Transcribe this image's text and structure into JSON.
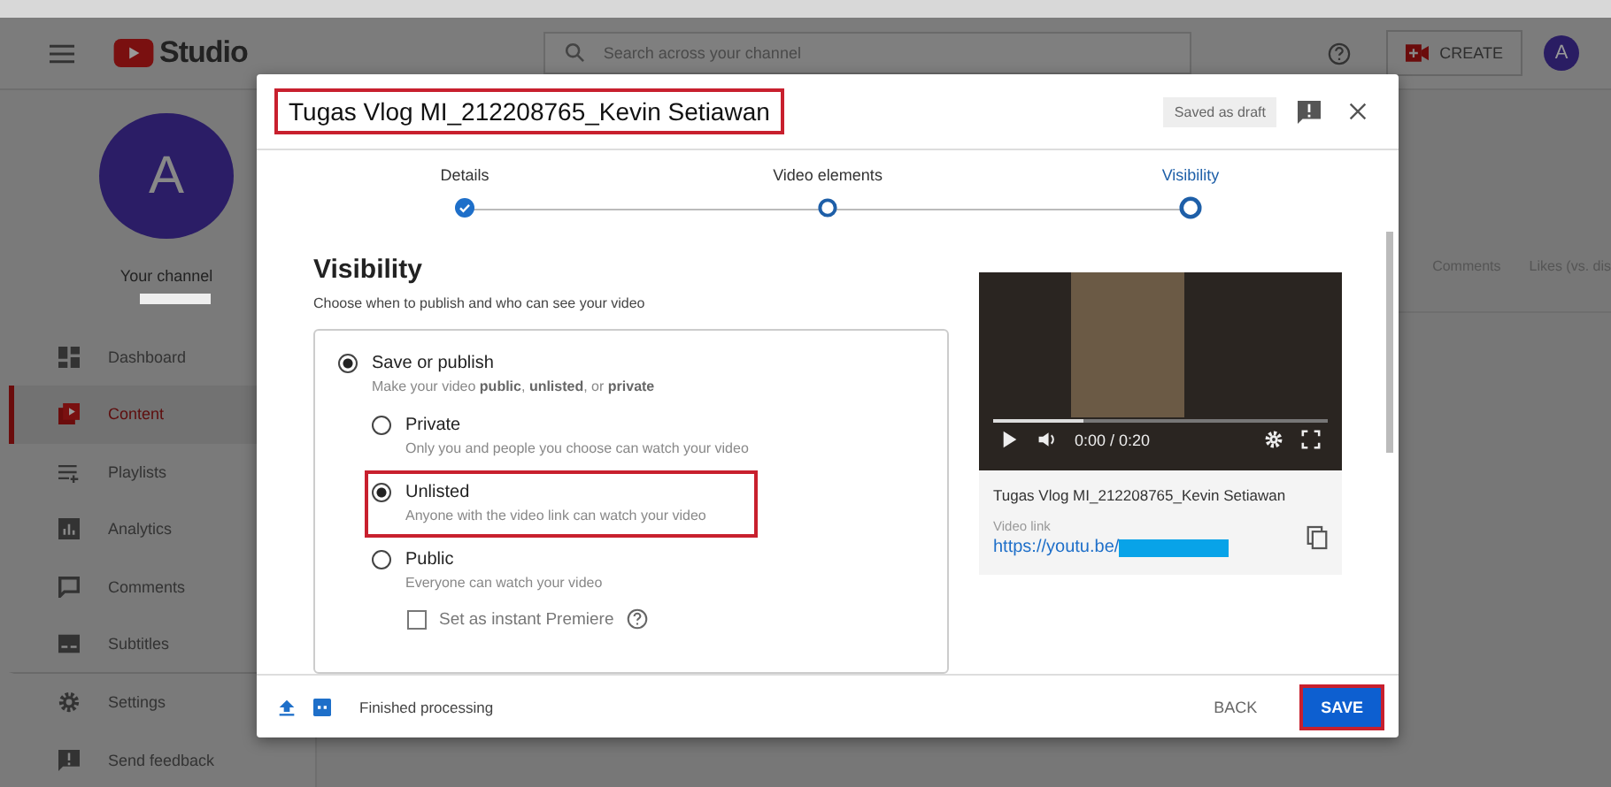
{
  "app_bar": {
    "logo_text": "Studio",
    "search_placeholder": "Search across your channel",
    "create_label": "CREATE",
    "avatar_letter": "A"
  },
  "sidebar": {
    "avatar_letter": "A",
    "channel_label": "Your channel",
    "items": [
      {
        "label": "Dashboard",
        "kind": "dashboard",
        "selected": false
      },
      {
        "label": "Content",
        "kind": "content",
        "selected": true
      },
      {
        "label": "Playlists",
        "kind": "playlists",
        "selected": false
      },
      {
        "label": "Analytics",
        "kind": "analytics",
        "selected": false
      },
      {
        "label": "Comments",
        "kind": "comments",
        "selected": false
      },
      {
        "label": "Subtitles",
        "kind": "subtitles",
        "selected": false
      },
      {
        "label": "Settings",
        "kind": "settings",
        "selected": false
      },
      {
        "label": "Send feedback",
        "kind": "feedback",
        "selected": false
      }
    ]
  },
  "background_table": {
    "columns": [
      "Comments",
      "Likes (vs. dis"
    ]
  },
  "dialog": {
    "title": "Tugas Vlog MI_212208765_Kevin Setiawan",
    "title_highlighted": true,
    "draft_status": "Saved as draft",
    "steps": [
      {
        "label": "Details",
        "done": true,
        "selected": false
      },
      {
        "label": "Video elements",
        "done": false,
        "selected": false
      },
      {
        "label": "Visibility",
        "done": false,
        "selected": true
      }
    ],
    "heading": "Visibility",
    "subheading": "Choose when to publish and who can see your video",
    "save_or_publish": {
      "label": "Save or publish",
      "description": "Make your video **public**, **unlisted**, or **private**",
      "selected": true
    },
    "options": [
      {
        "label": "Private",
        "description": "Only you and people you choose can watch your video",
        "selected": false,
        "highlighted": false
      },
      {
        "label": "Unlisted",
        "description": "Anyone with the video link can watch your video",
        "selected": true,
        "highlighted": true
      },
      {
        "label": "Public",
        "description": "Everyone can watch your video",
        "selected": false,
        "highlighted": false
      }
    ],
    "premiere": {
      "label": "Set as instant Premiere",
      "checked": false
    },
    "video": {
      "level": 0.27,
      "time": "0:00 / 0:20",
      "title": "Tugas Vlog MI_212208765_Kevin Setiawan",
      "link_label": "Video link",
      "link": "https://youtu.be/"
    },
    "footer": {
      "status": "Finished processing",
      "back_label": "BACK",
      "save_label": "SAVE",
      "save_highlighted": true
    }
  }
}
